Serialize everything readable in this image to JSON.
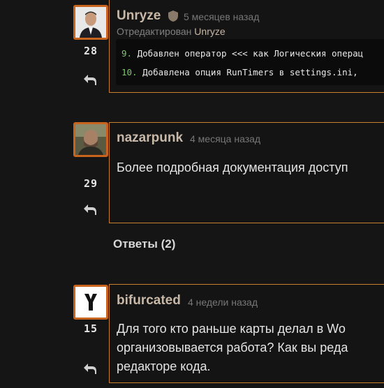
{
  "comments": [
    {
      "author": "Unryze",
      "time": "5 месяцев назад",
      "edited_prefix": "Отредактирован",
      "edited_by": "Unryze",
      "score": "28",
      "code_lines": [
        {
          "num": "9.",
          "text": " Добавлен оператор <<< как Логическия операц"
        },
        {
          "num": "10.",
          "text": " Добавлена опция RunTimers в settings.ini,"
        }
      ]
    },
    {
      "author": "nazarpunk",
      "time": "4 месяца назад",
      "score": "29",
      "body": "Более подробная документация доступ"
    },
    {
      "author": "bifurcated",
      "time": "4 недели назад",
      "score": "15",
      "body_lines": [
        "Для того кто раньше карты делал в Wo",
        "организовывается работа? Как вы реда",
        "редакторе кода."
      ]
    }
  ],
  "replies_label": "Ответы (2)",
  "icons": {
    "shield": "shield-icon",
    "reply": "reply-icon"
  },
  "colors": {
    "accent": "#c8802e",
    "avatar_border": "#c8641e",
    "background": "#151515"
  }
}
